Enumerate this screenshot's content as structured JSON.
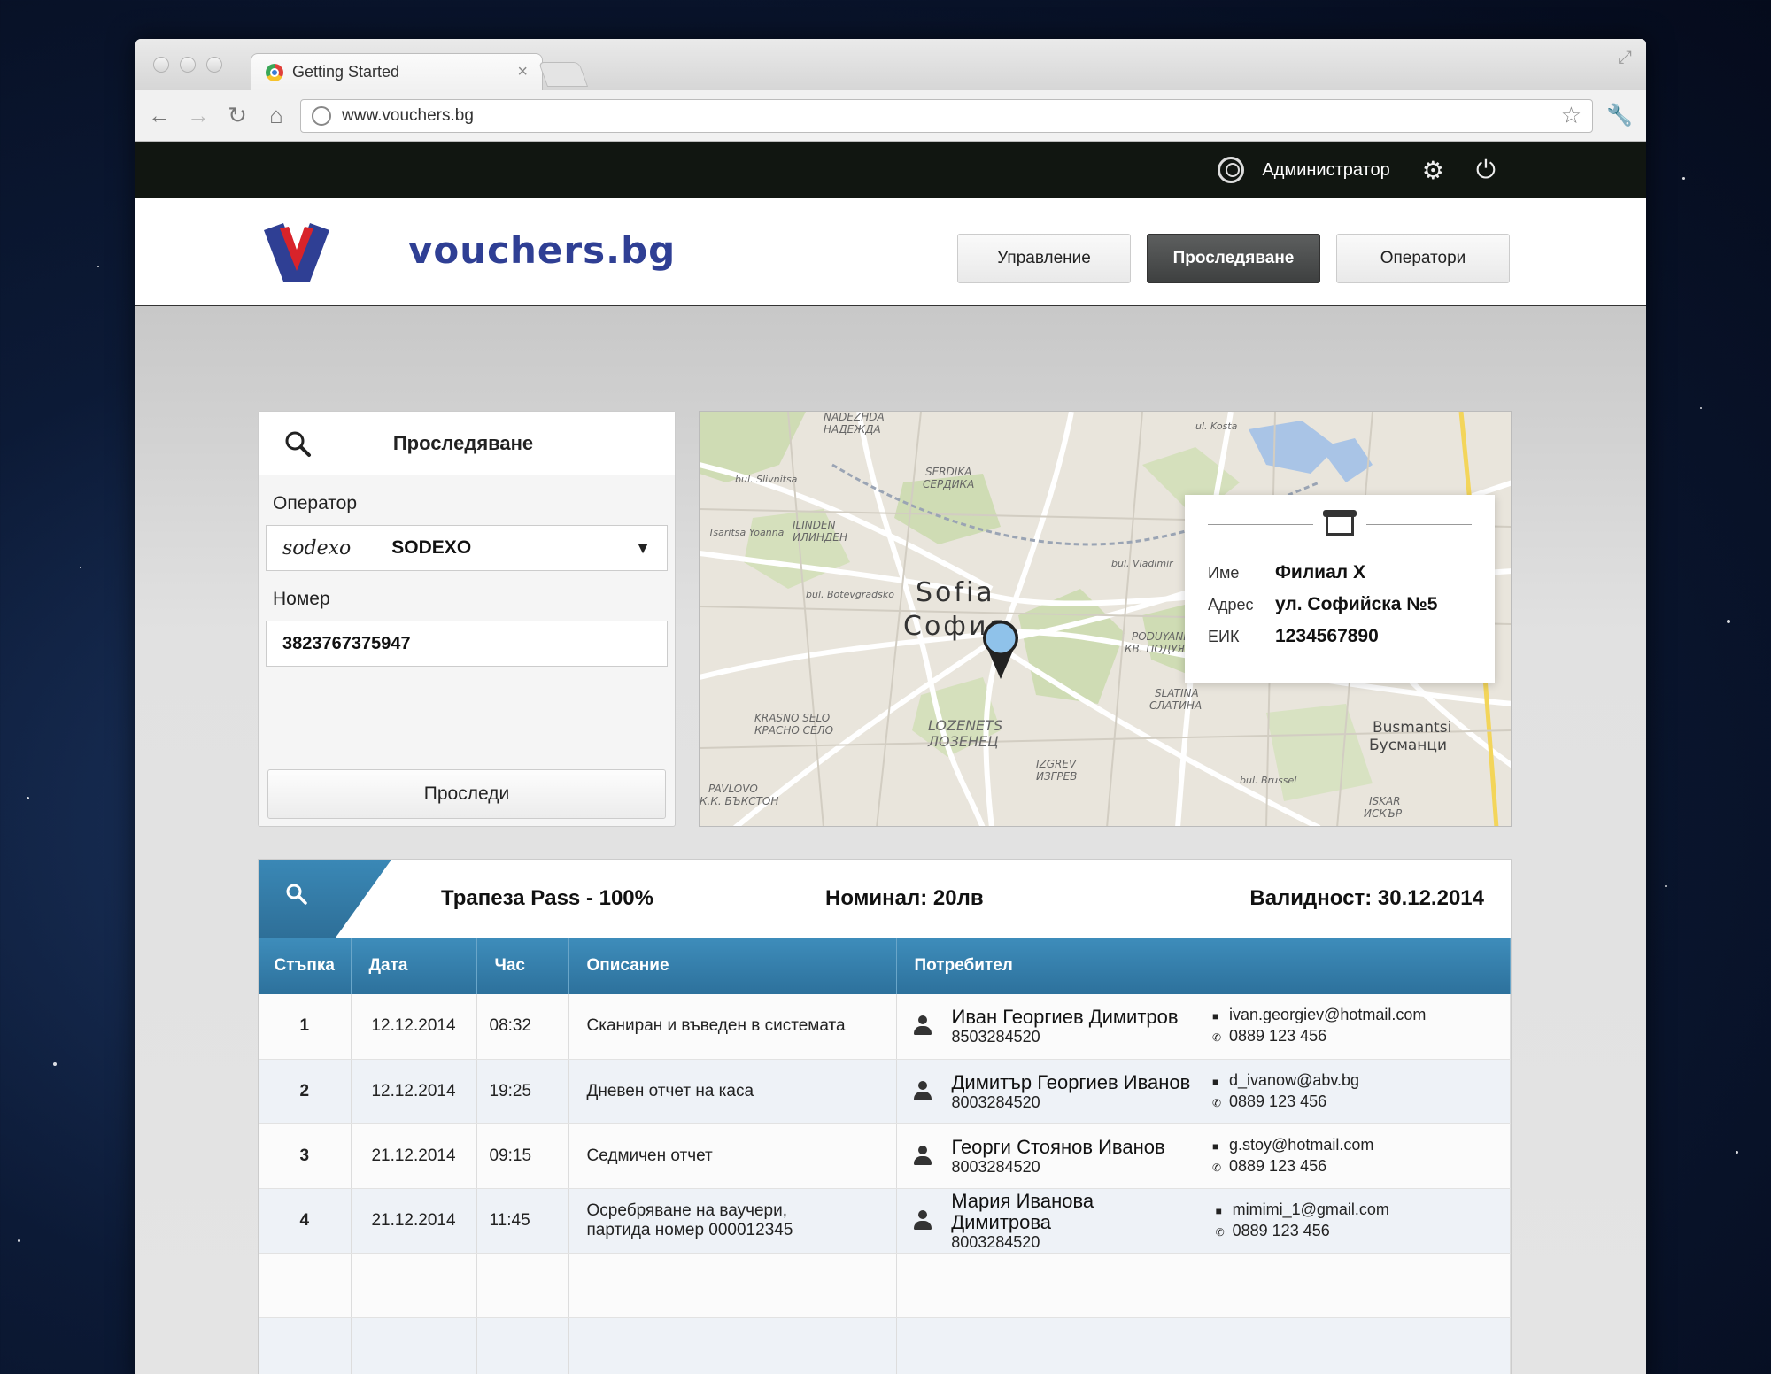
{
  "browser": {
    "tab_title": "Getting Started",
    "tab_close": "×",
    "url": "www.vouchers.bg"
  },
  "admin": {
    "user_label": "Администратор"
  },
  "site": {
    "logo_text": "vouchers.bg",
    "nav": [
      {
        "label": "Управление",
        "active": false
      },
      {
        "label": "Проследяване",
        "active": true
      },
      {
        "label": "Оператори",
        "active": false
      }
    ]
  },
  "search": {
    "title": "Проследяване",
    "operator_label": "Оператор",
    "operator_logo": "sodexo",
    "operator_value": "SODEXO",
    "number_label": "Номер",
    "number_value": "3823767375947",
    "track_button": "Проследи"
  },
  "map": {
    "labels": [
      {
        "text": "NADEZHDA"
      },
      {
        "text": "НАДЕЖДА"
      },
      {
        "text": "SERDIKA"
      },
      {
        "text": "СЕРДИКА"
      },
      {
        "text": "ILINDEN"
      },
      {
        "text": "ИЛИНДЕН"
      },
      {
        "text": "Sofia"
      },
      {
        "text": "София"
      },
      {
        "text": "PODUYANE"
      },
      {
        "text": "КВ. ПОДУЯНЕ"
      },
      {
        "text": "SLATINA"
      },
      {
        "text": "СЛАТИНА"
      },
      {
        "text": "KRASNO SELO"
      },
      {
        "text": "КРАСНО СЕЛО"
      },
      {
        "text": "LOZENETS"
      },
      {
        "text": "ЛОЗЕНЕЦ"
      },
      {
        "text": "IZGREV"
      },
      {
        "text": "ИЗГРЕВ"
      },
      {
        "text": "PAVLOVO"
      },
      {
        "text": "К.К. БЪКСТОН"
      },
      {
        "text": "Busmantsi"
      },
      {
        "text": "Бусманци"
      },
      {
        "text": "ISKAR"
      },
      {
        "text": "ИСКЪР"
      },
      {
        "text": "bul. Slivnitsa"
      },
      {
        "text": "bul. Vladimir"
      },
      {
        "text": "Tsaritsa Yoanna"
      },
      {
        "text": "ul. Kosta"
      },
      {
        "text": "bul. Botevgradsko"
      },
      {
        "text": "bul. Brussel"
      }
    ],
    "card": {
      "name_key": "Име",
      "name_val": "Филиал Х",
      "address_key": "Адрес",
      "address_val": "ул. Софийска №5",
      "eik_key": "ЕИК",
      "eik_val": "1234567890"
    }
  },
  "results": {
    "product": "Трапеза Pass - 100%",
    "nominal": "Номинал: 20лв",
    "validity": "Валидност: 30.12.2014",
    "columns": [
      "Стъпка",
      "Дата",
      "Час",
      "Описание",
      "Потребител"
    ],
    "rows": [
      {
        "step": "1",
        "date": "12.12.2014",
        "time": "08:32",
        "desc1": "Сканиран и въведен в системата",
        "desc2": "",
        "name": "Иван Георгиев Димитров",
        "id": "8503284520",
        "email": "ivan.georgiev@hotmail.com",
        "phone": "0889 123 456"
      },
      {
        "step": "2",
        "date": "12.12.2014",
        "time": "19:25",
        "desc1": "Дневен отчет на каса",
        "desc2": "",
        "name": "Димитър Георгиев Иванов",
        "id": "8003284520",
        "email": "d_ivanow@abv.bg",
        "phone": "0889 123 456"
      },
      {
        "step": "3",
        "date": "21.12.2014",
        "time": "09:15",
        "desc1": "Седмичен отчет",
        "desc2": "",
        "name": "Георги Стоянов Иванов",
        "id": "8003284520",
        "email": "g.stoy@hotmail.com",
        "phone": "0889 123 456"
      },
      {
        "step": "4",
        "date": "21.12.2014",
        "time": "11:45",
        "desc1": "Осребряване на ваучери,",
        "desc2": "партида номер 000012345",
        "name": "Мария Иванова Димитрова",
        "id": "8003284520",
        "email": "mimimi_1@gmail.com",
        "phone": "0889 123 456"
      }
    ]
  },
  "colors": {
    "accent_blue": "#2d719c",
    "admin_bar": "#111611",
    "logo_red": "#d8232a",
    "logo_blue": "#2f3f94"
  }
}
